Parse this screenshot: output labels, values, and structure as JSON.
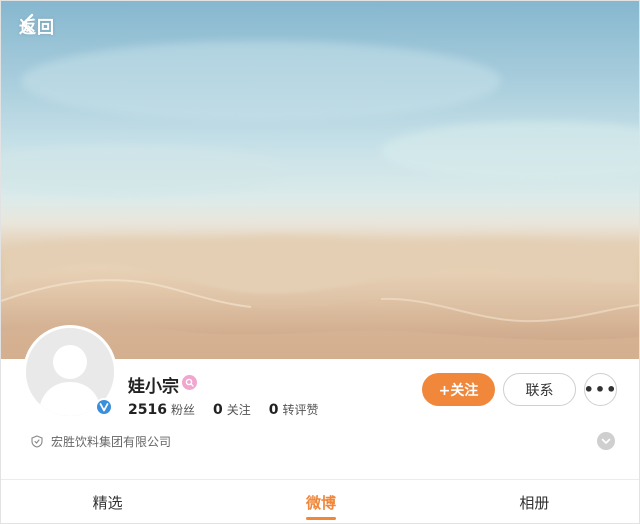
{
  "header": {
    "back_label": "返回"
  },
  "profile": {
    "name": "娃小宗",
    "stats": [
      {
        "value": "2516",
        "label": "粉丝"
      },
      {
        "value": "0",
        "label": "关注"
      },
      {
        "value": "0",
        "label": "转评赞"
      }
    ],
    "company": "宏胜饮料集团有限公司"
  },
  "actions": {
    "follow_label": "+关注",
    "contact_label": "联系",
    "more_label": "•••"
  },
  "tabs": [
    {
      "label": "精选",
      "active": false
    },
    {
      "label": "微博",
      "active": true
    },
    {
      "label": "相册",
      "active": false
    }
  ],
  "colors": {
    "accent": "#f0873a",
    "verified": "#3a8fdc",
    "badge": "#f0a6cf"
  }
}
